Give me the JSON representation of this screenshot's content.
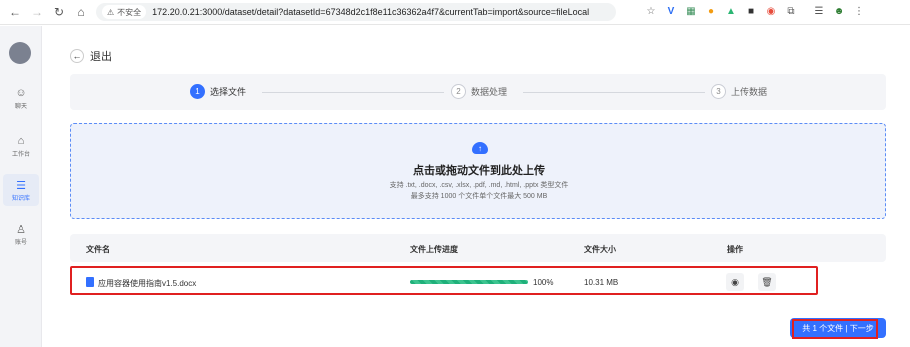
{
  "browser": {
    "security_label": "不安全",
    "url": "172.20.0.21:3000/dataset/detail?datasetId=67348d2c1f8e11c36362a4f7&currentTab=import&source=fileLocal"
  },
  "sidebar": {
    "items": [
      {
        "label": "聊天",
        "icon": "chat-icon"
      },
      {
        "label": "工作台",
        "icon": "workbench-icon"
      },
      {
        "label": "知识库",
        "icon": "database-icon"
      },
      {
        "label": "账号",
        "icon": "user-icon"
      }
    ],
    "active_color": "#3370ff"
  },
  "main": {
    "back_label": "退出",
    "steps": [
      {
        "num": "1",
        "label": "选择文件"
      },
      {
        "num": "2",
        "label": "数据处理"
      },
      {
        "num": "3",
        "label": "上传数据"
      }
    ],
    "upload": {
      "title": "点击或拖动文件到此处上传",
      "formats": "支持 .txt, .docx, .csv, .xlsx, .pdf, .md, .html, .pptx 类型文件",
      "limit": "最多支持 1000 个文件单个文件最大 500 MB"
    },
    "table": {
      "headers": [
        "文件名",
        "文件上传进度",
        "文件大小",
        "操作"
      ],
      "rows": [
        {
          "name": "应用容器使用指南v1.5.docx",
          "progress": 100,
          "progress_label": "100%",
          "size": "10.31 MB"
        }
      ]
    },
    "next_button": "共 1 个文件 | 下一步"
  },
  "colors": {
    "accent": "#3370ff",
    "highlight": "#e02020",
    "progress": "#1fb07a"
  }
}
